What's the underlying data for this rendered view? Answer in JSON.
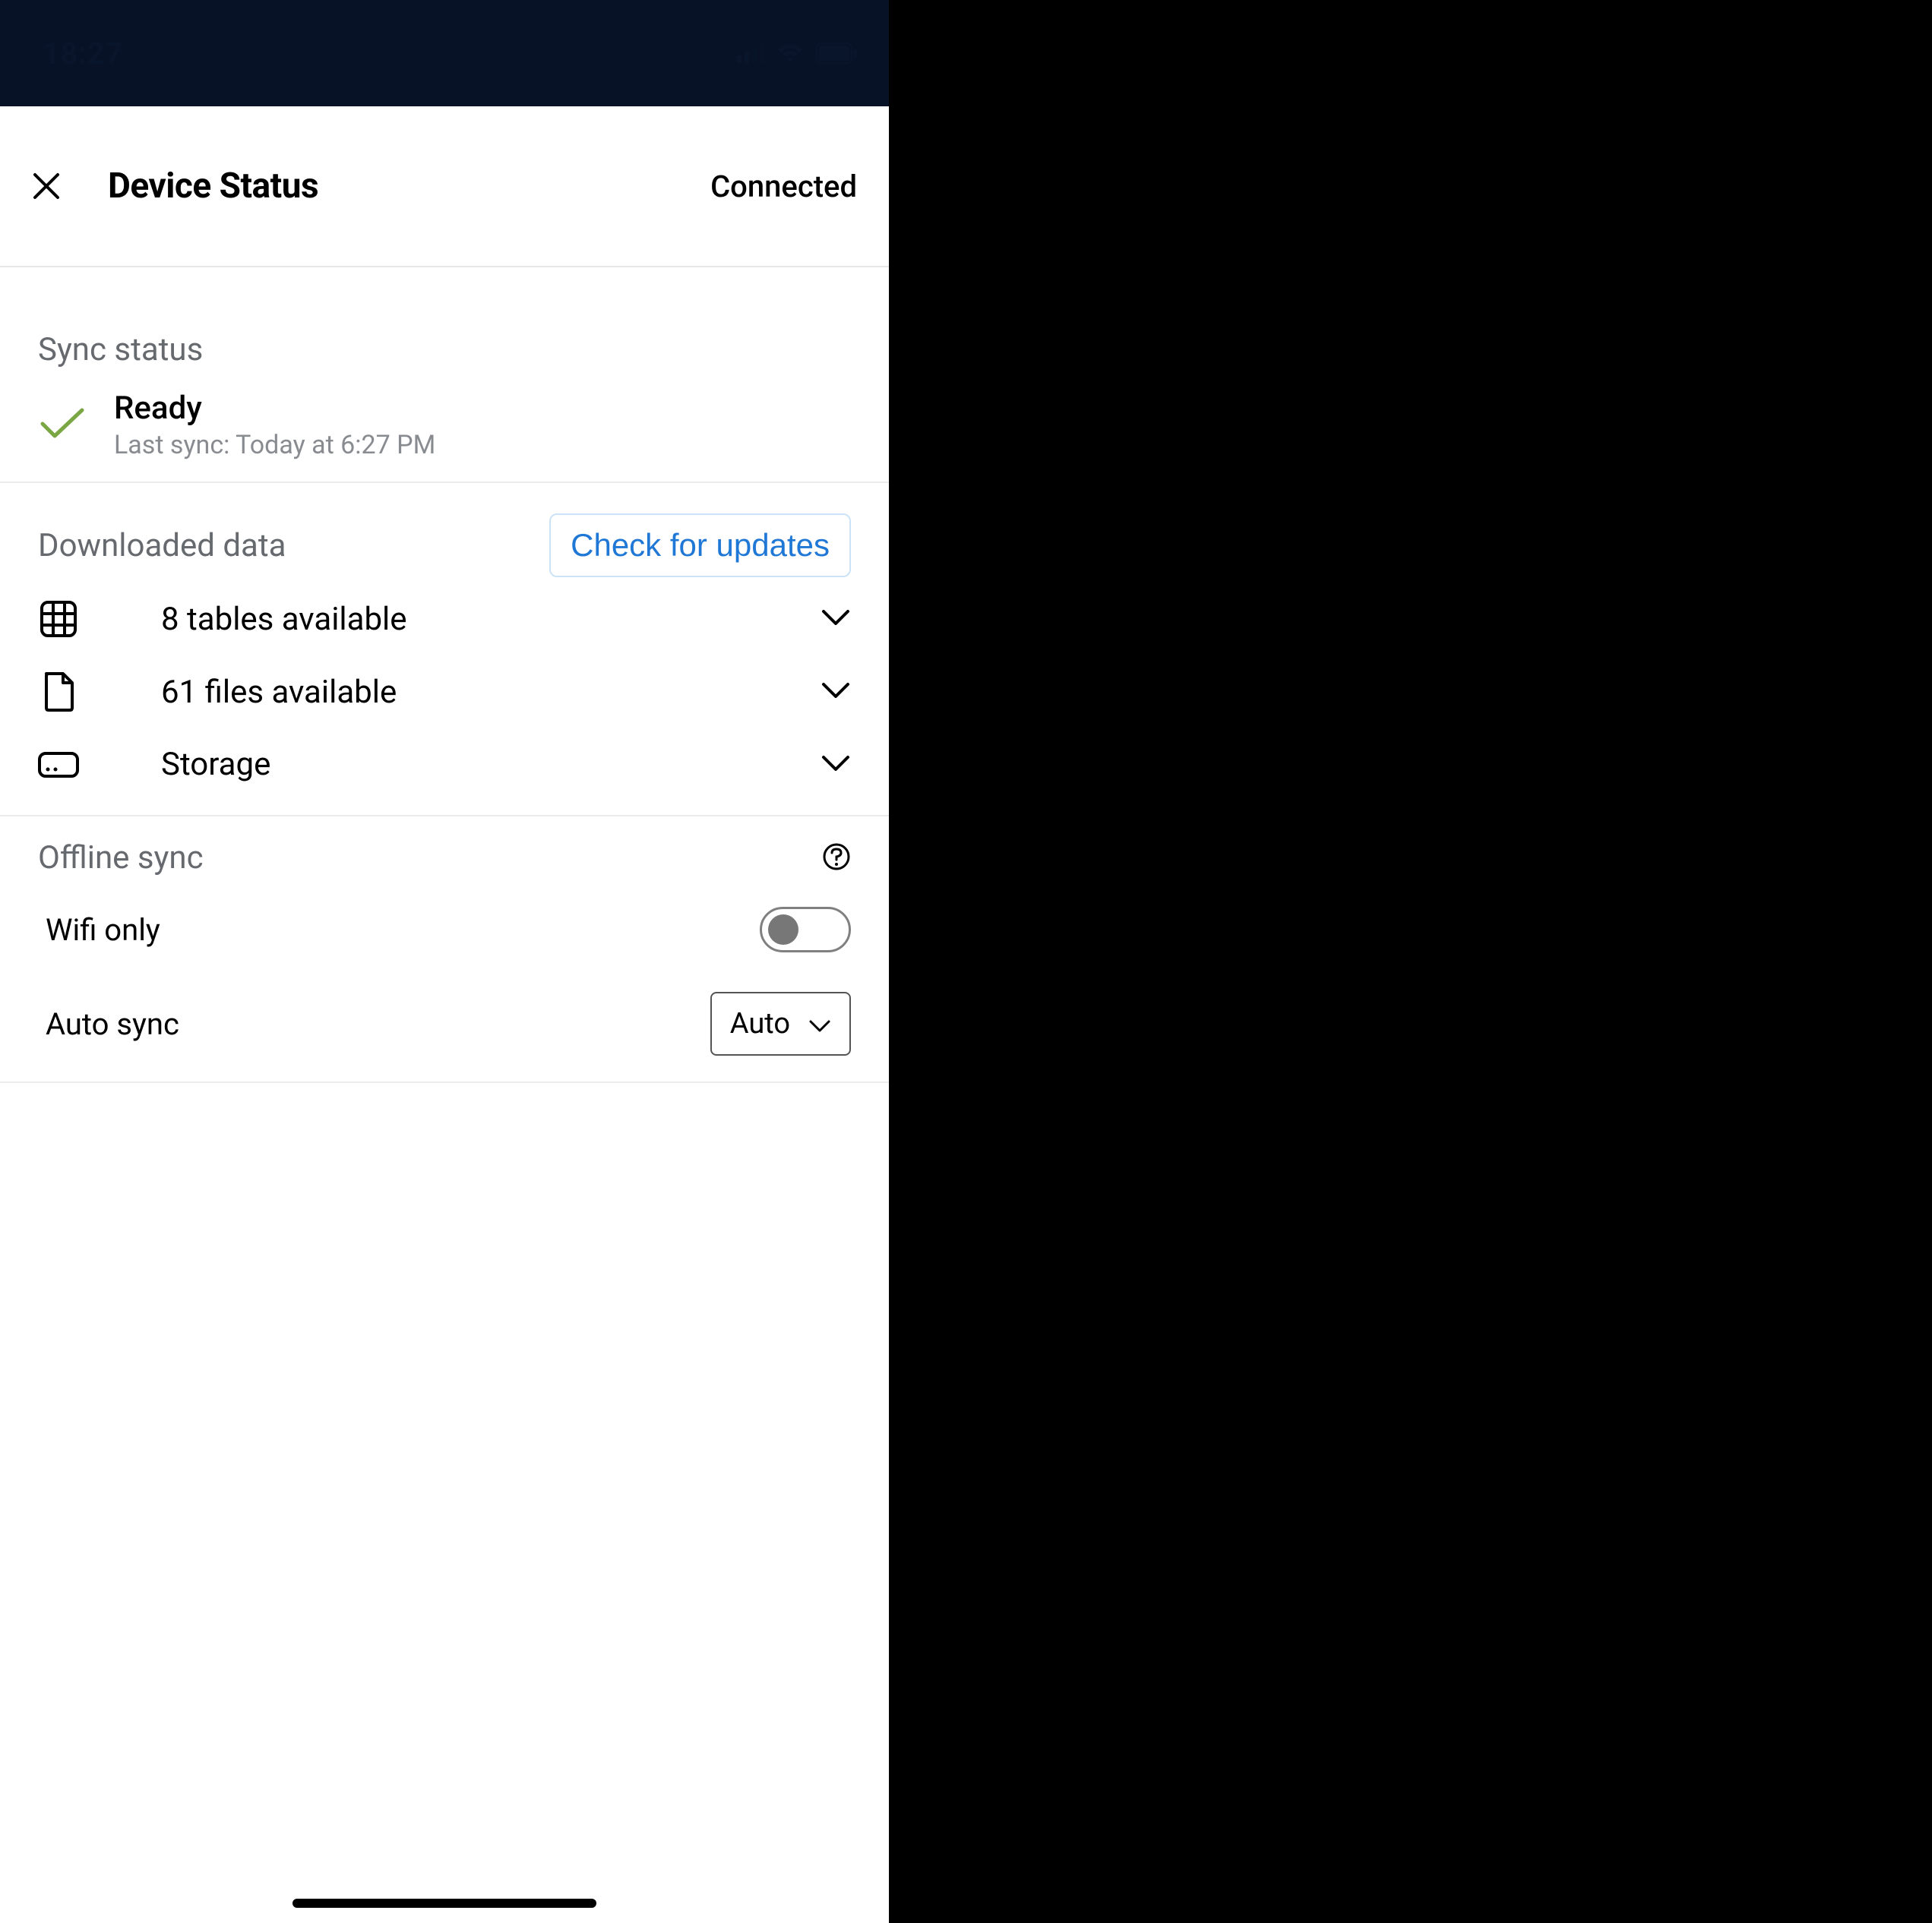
{
  "statusbar": {
    "time": "18:27"
  },
  "nav": {
    "title": "Device Status",
    "connected": "Connected"
  },
  "sync": {
    "section_label": "Sync status",
    "state": "Ready",
    "last_sync": "Last sync: Today at 6:27 PM"
  },
  "downloaded": {
    "section_label": "Downloaded data",
    "check_label": "Check for updates",
    "rows": {
      "tables": "8 tables available",
      "files": "61 files available",
      "storage": "Storage"
    }
  },
  "offline": {
    "section_label": "Offline sync",
    "wifi_label": "Wifi only",
    "auto_label": "Auto sync",
    "auto_value": "Auto"
  }
}
